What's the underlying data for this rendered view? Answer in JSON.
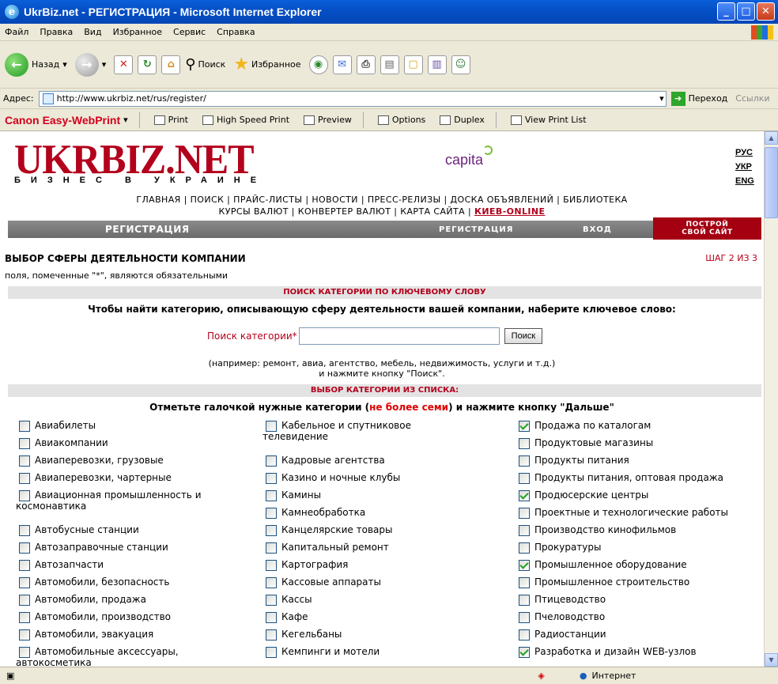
{
  "window": {
    "title": "UkrBiz.net - РЕГИСТРАЦИЯ - Microsoft Internet Explorer"
  },
  "menu": [
    "Файл",
    "Правка",
    "Вид",
    "Избранное",
    "Сервис",
    "Справка"
  ],
  "toolbar": {
    "back": "Назад",
    "search": "Поиск",
    "favorites": "Избранное"
  },
  "address": {
    "label": "Адрес:",
    "url": "http://www.ukrbiz.net/rus/register/",
    "go": "Переход",
    "links": "Ссылки"
  },
  "canon": {
    "brand": "Canon",
    "app": "Easy-WebPrint",
    "print": "Print",
    "hsprint": "High Speed Print",
    "preview": "Preview",
    "options": "Options",
    "duplex": "Duplex",
    "viewlist": "View Print List"
  },
  "site": {
    "logo": "UKRBIZ.NET",
    "logo_sub": "БИЗНЕС В УКРАИНЕ",
    "capita": "capita",
    "langs": [
      "РУС",
      "УКР",
      "ENG"
    ],
    "nav1": "ГЛАВНАЯ | ПОИСК | ПРАЙС-ЛИСТЫ | НОВОСТИ | ПРЕСС-РЕЛИЗЫ | ДОСКА ОБЪЯВЛЕНИЙ | БИБЛИОТЕКА",
    "nav2_a": "КУРСЫ ВАЛЮТ | КОНВЕРТЕР ВАЛЮТ | КАРТА САЙТА | ",
    "nav2_kiev": "КИЕВ-ONLINE",
    "regbar": {
      "title": "РЕГИСТРАЦИЯ",
      "reg": "РЕГИСТРАЦИЯ",
      "login": "ВХОД",
      "build1": "ПОСТРОЙ",
      "build2": "СВОЙ САЙТ"
    }
  },
  "page": {
    "heading": "ВЫБОР СФЕРЫ ДЕЯТЕЛЬНОСТИ КОМПАНИИ",
    "step": "ШАГ 2 ИЗ 3",
    "required": "поля, помеченные \"*\", являются обязательными",
    "sec1": "ПОИСК КАТЕГОРИИ ПО КЛЮЧЕВОМУ СЛОВУ",
    "instr1": "Чтобы найти категорию, описывающую сферу деятельности вашей компании, наберите ключевое слово:",
    "search_label": "Поиск категории*",
    "search_value": "",
    "search_btn": "Поиск",
    "example1": "(например: ремонт, авиа, агентство, мебель, недвижимость, услуги и т.д.)",
    "example2": "и нажмите кнопку \"Поиск\".",
    "sec2": "ВЫБОР КАТЕГОРИИ ИЗ СПИСКА:",
    "instr2_a": "Отметьте галочкой нужные категории (",
    "instr2_b": "не более семи",
    "instr2_c": ") и нажмите кнопку \"Дальше\""
  },
  "columns": [
    [
      {
        "label": "Авиабилеты",
        "checked": false
      },
      {
        "label": "Авиакомпании",
        "checked": false
      },
      {
        "label": "Авиаперевозки, грузовые",
        "checked": false
      },
      {
        "label": "Авиаперевозки, чартерные",
        "checked": false
      },
      {
        "label": "Авиационная промышленность и",
        "label2": "космонавтика",
        "checked": false
      },
      {
        "label": "Автобусные станции",
        "checked": false
      },
      {
        "label": "Автозаправочные станции",
        "checked": false
      },
      {
        "label": "Автозапчасти",
        "checked": false
      },
      {
        "label": "Автомобили, безопасность",
        "checked": false
      },
      {
        "label": "Автомобили, продажа",
        "checked": false
      },
      {
        "label": "Автомобили, производство",
        "checked": false
      },
      {
        "label": "Автомобили, эвакуация",
        "checked": false
      },
      {
        "label": "Автомобильные аксессуары,",
        "label2": "автокосметика",
        "checked": false
      }
    ],
    [
      {
        "label": "Кабельное и спутниковое",
        "label2": "телевидение",
        "checked": false
      },
      {
        "label": "Кадровые агентства",
        "checked": false
      },
      {
        "label": "Казино и ночные клубы",
        "checked": false
      },
      {
        "label": "Камины",
        "checked": false
      },
      {
        "label": "Камнеобработка",
        "checked": false
      },
      {
        "label": "Канцелярские товары",
        "checked": false
      },
      {
        "label": "Капитальный ремонт",
        "checked": false
      },
      {
        "label": "Картография",
        "checked": false
      },
      {
        "label": "Кассовые аппараты",
        "checked": false
      },
      {
        "label": "Кассы",
        "checked": false
      },
      {
        "label": "Кафе",
        "checked": false
      },
      {
        "label": "Кегельбаны",
        "checked": false
      },
      {
        "label": "Кемпинги и мотели",
        "checked": false
      }
    ],
    [
      {
        "label": "Продажа по каталогам",
        "checked": true
      },
      {
        "label": "Продуктовые магазины",
        "checked": false
      },
      {
        "label": "Продукты питания",
        "checked": false
      },
      {
        "label": "Продукты питания, оптовая продажа",
        "checked": false
      },
      {
        "label": "Продюсерские центры",
        "checked": true
      },
      {
        "label": "Проектные и технологические работы",
        "checked": false
      },
      {
        "label": "Производство кинофильмов",
        "checked": false
      },
      {
        "label": "Прокуратуры",
        "checked": false
      },
      {
        "label": "Промышленное оборудование",
        "checked": true
      },
      {
        "label": "Промышленное строительство",
        "checked": false
      },
      {
        "label": "Птицеводство",
        "checked": false
      },
      {
        "label": "Пчеловодство",
        "checked": false
      },
      {
        "label": "Радиостанции",
        "checked": false
      },
      {
        "label": "Разработка и дизайн WEB-узлов",
        "checked": true
      }
    ]
  ],
  "status": {
    "zone": "Интернет"
  }
}
